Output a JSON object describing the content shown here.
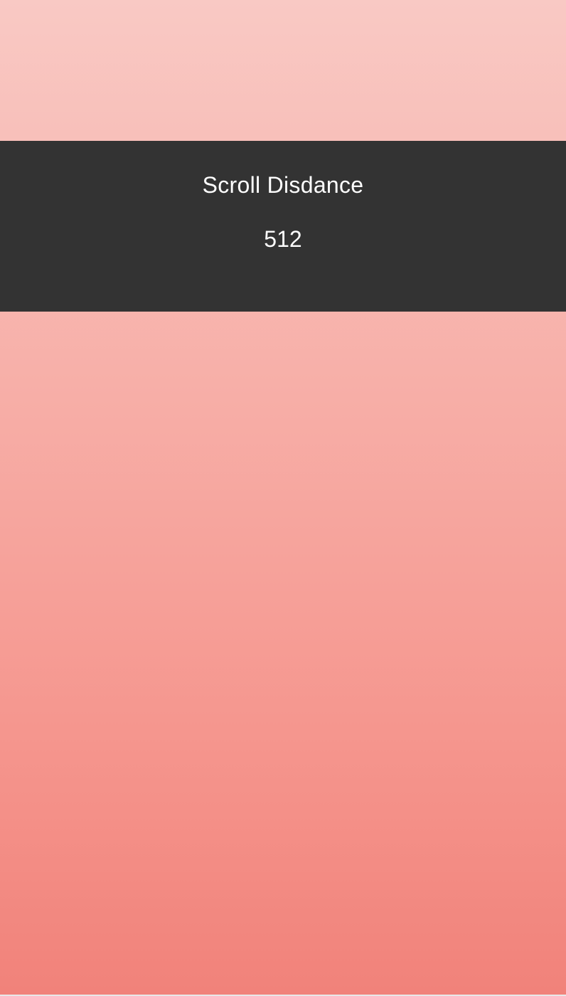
{
  "scroll_panel": {
    "title": "Scroll Disdance",
    "value": "512"
  },
  "colors": {
    "panel_background": "#333333",
    "text": "#ffffff",
    "gradient_top": "#f9c9c4",
    "gradient_bottom": "#f1827a"
  }
}
